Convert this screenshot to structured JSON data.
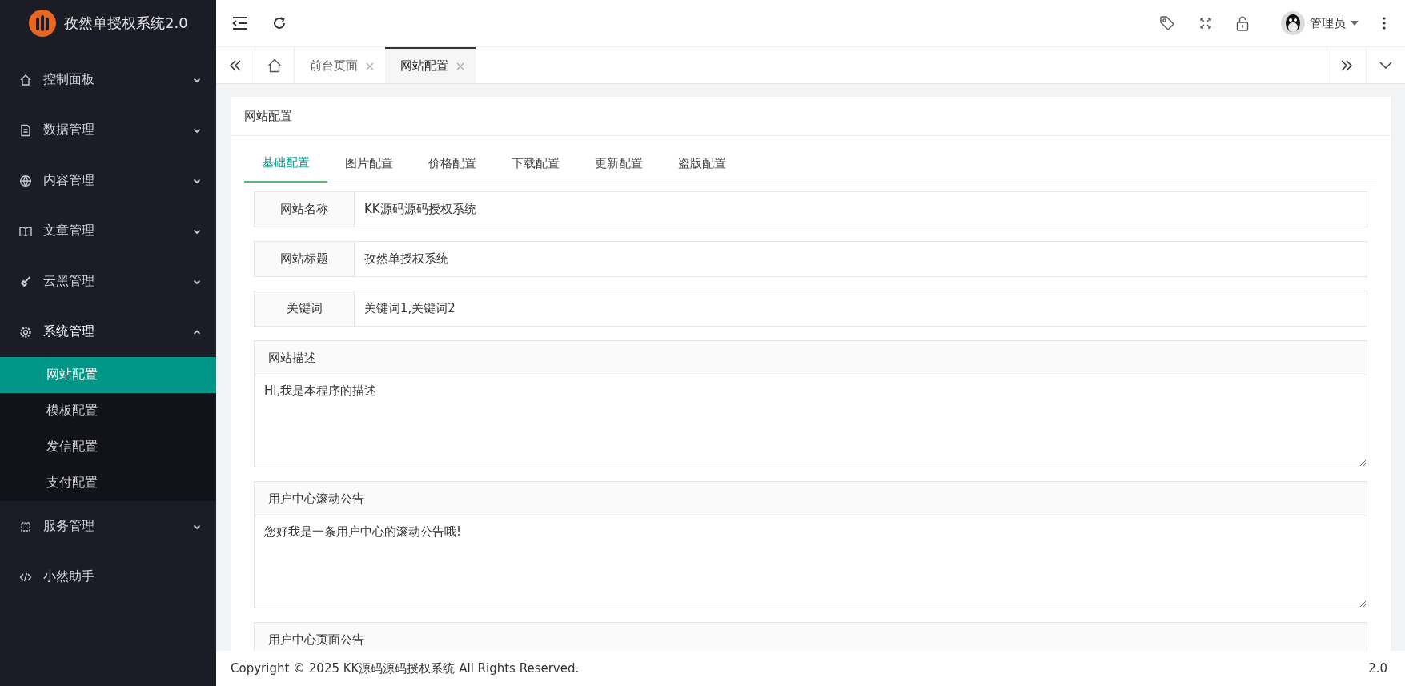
{
  "brand": {
    "title": "孜然单授权系统2.0"
  },
  "sidebar": {
    "items": [
      {
        "label": "控制面板",
        "expanded": false
      },
      {
        "label": "数据管理",
        "expanded": false
      },
      {
        "label": "内容管理",
        "expanded": false
      },
      {
        "label": "文章管理",
        "expanded": false
      },
      {
        "label": "云黑管理",
        "expanded": false
      },
      {
        "label": "系统管理",
        "expanded": true,
        "children": [
          {
            "label": "网站配置",
            "selected": true
          },
          {
            "label": "模板配置",
            "selected": false
          },
          {
            "label": "发信配置",
            "selected": false
          },
          {
            "label": "支付配置",
            "selected": false
          }
        ]
      },
      {
        "label": "服务管理",
        "expanded": false
      },
      {
        "label": "小然助手"
      }
    ]
  },
  "header": {
    "user": "管理员"
  },
  "page_tabs": [
    {
      "label": "前台页面",
      "selected": false
    },
    {
      "label": "网站配置",
      "selected": true
    }
  ],
  "card": {
    "title": "网站配置",
    "tabs": [
      {
        "label": "基础配置",
        "selected": true
      },
      {
        "label": "图片配置",
        "selected": false
      },
      {
        "label": "价格配置",
        "selected": false
      },
      {
        "label": "下载配置",
        "selected": false
      },
      {
        "label": "更新配置",
        "selected": false
      },
      {
        "label": "盗版配置",
        "selected": false
      }
    ],
    "fields": [
      {
        "kind": "input",
        "label": "网站名称",
        "value": "KK源码源码授权系统"
      },
      {
        "kind": "input",
        "label": "网站标题",
        "value": "孜然单授权系统"
      },
      {
        "kind": "input",
        "label": "关键词",
        "value": "关键词1,关键词2"
      },
      {
        "kind": "textarea",
        "label": "网站描述",
        "value": "Hi,我是本程序的描述"
      },
      {
        "kind": "textarea",
        "label": "用户中心滚动公告",
        "value": "您好我是一条用户中心的滚动公告哦!"
      },
      {
        "kind": "textarea",
        "label": "用户中心页面公告"
      }
    ]
  },
  "footer": {
    "copyright": "Copyright © 2025 KK源码源码授权系统 All Rights Reserved.",
    "version": "2.0"
  }
}
